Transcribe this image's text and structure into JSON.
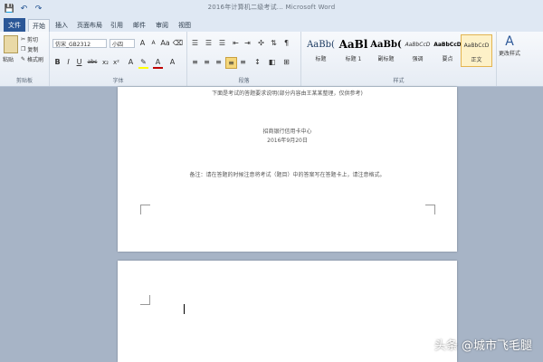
{
  "window": {
    "title": "2016年计算机二级考试... Microsoft Word",
    "controls": [
      "—",
      "□",
      "✕"
    ]
  },
  "qat": {
    "save": "💾",
    "undo": "↶",
    "redo": "↷"
  },
  "tabs": [
    {
      "label": "文件"
    },
    {
      "label": "开始"
    },
    {
      "label": "插入"
    },
    {
      "label": "页面布局"
    },
    {
      "label": "引用"
    },
    {
      "label": "邮件"
    },
    {
      "label": "审阅"
    },
    {
      "label": "视图"
    }
  ],
  "clipboard": {
    "paste": "粘贴",
    "cut": "剪切",
    "copy": "复制",
    "format_painter": "格式刷",
    "label": "剪贴板"
  },
  "font": {
    "name": "仿宋_GB2312",
    "size": "小四",
    "grow": "A",
    "shrink": "A",
    "bold": "B",
    "italic": "I",
    "underline": "U",
    "strike": "abc",
    "sub": "x₂",
    "sup": "x²",
    "label": "字体",
    "color_accent": "#c00000",
    "highlight_accent": "#ffff00"
  },
  "paragraph": {
    "label": "段落"
  },
  "styles": {
    "items": [
      {
        "preview": "AaBb(",
        "name": "标题"
      },
      {
        "preview": "AaBl",
        "name": "标题 1"
      },
      {
        "preview": "AaBb(",
        "name": "副标题"
      },
      {
        "preview": "AaBbCcD",
        "name": "强调"
      },
      {
        "preview": "AaBbCcD",
        "name": "要点"
      },
      {
        "preview": "AaBbCcD",
        "name": "正文"
      }
    ],
    "change": "更改样式",
    "label": "样式"
  },
  "document": {
    "page1_line1": "下面是考试的答题要求说明(部分内容由王某某整理，仅供参考)",
    "page1_line2": "招商银行信用卡中心",
    "page1_line3": "2016年9月20日",
    "page1_line4": "备注：请在答题的时候注意将考试（题目）中的答案写在答题卡上，请注意格式。"
  },
  "watermark": "头条 @城市飞毛腿"
}
